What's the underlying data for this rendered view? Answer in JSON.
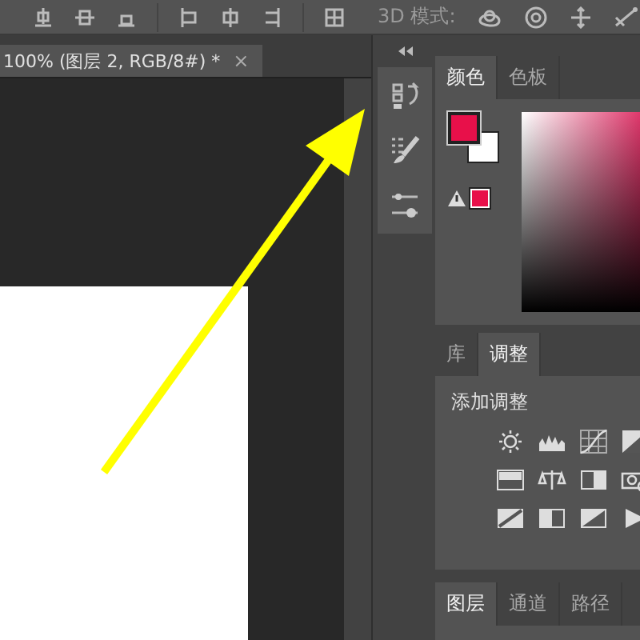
{
  "options_bar": {
    "mode_label": "3D 模式:"
  },
  "document_tab": {
    "title": "100% (图层 2, RGB/8#) *",
    "close": "×"
  },
  "color_panel": {
    "tabs": [
      {
        "label": "颜色",
        "selected": true
      },
      {
        "label": "色板",
        "selected": false
      }
    ]
  },
  "adjustments_panel": {
    "tabs": [
      {
        "label": "库",
        "selected": false
      },
      {
        "label": "调整",
        "selected": true
      }
    ],
    "heading": "添加调整"
  },
  "layers_panel": {
    "tabs": [
      {
        "label": "图层",
        "selected": true
      },
      {
        "label": "通道",
        "selected": false
      },
      {
        "label": "路径",
        "selected": false
      }
    ]
  }
}
